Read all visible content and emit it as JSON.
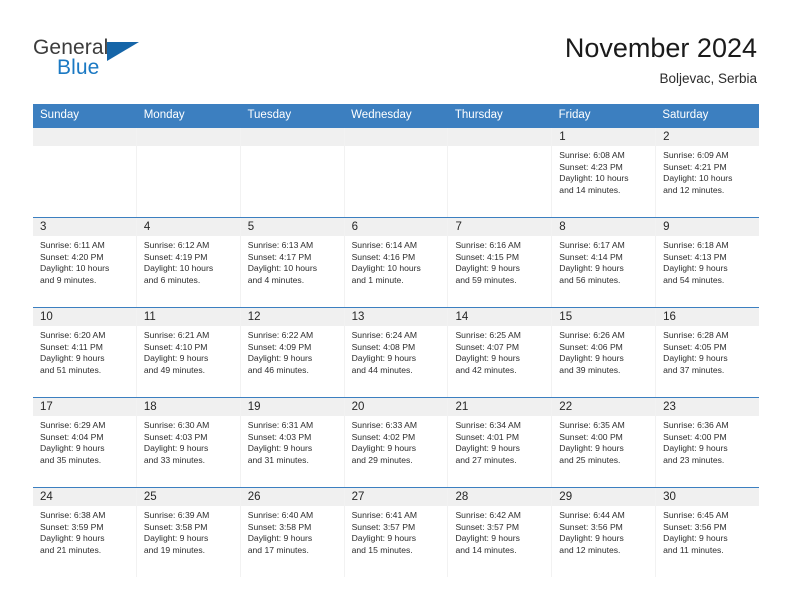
{
  "brand": {
    "name_primary": "General",
    "name_secondary": "Blue",
    "primary_color": "#3c3c3c",
    "secondary_color": "#1b79c3",
    "mark_color": "#1565a8"
  },
  "header": {
    "title": "November 2024",
    "location": "Boljevac, Serbia"
  },
  "calendar": {
    "accent_color": "#3c7fc0",
    "daynum_bg": "#f0f0f0",
    "weekdays": [
      "Sunday",
      "Monday",
      "Tuesday",
      "Wednesday",
      "Thursday",
      "Friday",
      "Saturday"
    ],
    "weeks": [
      [
        {
          "day": "",
          "sunrise": "",
          "sunset": "",
          "daylight_1": "",
          "daylight_2": ""
        },
        {
          "day": "",
          "sunrise": "",
          "sunset": "",
          "daylight_1": "",
          "daylight_2": ""
        },
        {
          "day": "",
          "sunrise": "",
          "sunset": "",
          "daylight_1": "",
          "daylight_2": ""
        },
        {
          "day": "",
          "sunrise": "",
          "sunset": "",
          "daylight_1": "",
          "daylight_2": ""
        },
        {
          "day": "",
          "sunrise": "",
          "sunset": "",
          "daylight_1": "",
          "daylight_2": ""
        },
        {
          "day": "1",
          "sunrise": "Sunrise: 6:08 AM",
          "sunset": "Sunset: 4:23 PM",
          "daylight_1": "Daylight: 10 hours",
          "daylight_2": "and 14 minutes."
        },
        {
          "day": "2",
          "sunrise": "Sunrise: 6:09 AM",
          "sunset": "Sunset: 4:21 PM",
          "daylight_1": "Daylight: 10 hours",
          "daylight_2": "and 12 minutes."
        }
      ],
      [
        {
          "day": "3",
          "sunrise": "Sunrise: 6:11 AM",
          "sunset": "Sunset: 4:20 PM",
          "daylight_1": "Daylight: 10 hours",
          "daylight_2": "and 9 minutes."
        },
        {
          "day": "4",
          "sunrise": "Sunrise: 6:12 AM",
          "sunset": "Sunset: 4:19 PM",
          "daylight_1": "Daylight: 10 hours",
          "daylight_2": "and 6 minutes."
        },
        {
          "day": "5",
          "sunrise": "Sunrise: 6:13 AM",
          "sunset": "Sunset: 4:17 PM",
          "daylight_1": "Daylight: 10 hours",
          "daylight_2": "and 4 minutes."
        },
        {
          "day": "6",
          "sunrise": "Sunrise: 6:14 AM",
          "sunset": "Sunset: 4:16 PM",
          "daylight_1": "Daylight: 10 hours",
          "daylight_2": "and 1 minute."
        },
        {
          "day": "7",
          "sunrise": "Sunrise: 6:16 AM",
          "sunset": "Sunset: 4:15 PM",
          "daylight_1": "Daylight: 9 hours",
          "daylight_2": "and 59 minutes."
        },
        {
          "day": "8",
          "sunrise": "Sunrise: 6:17 AM",
          "sunset": "Sunset: 4:14 PM",
          "daylight_1": "Daylight: 9 hours",
          "daylight_2": "and 56 minutes."
        },
        {
          "day": "9",
          "sunrise": "Sunrise: 6:18 AM",
          "sunset": "Sunset: 4:13 PM",
          "daylight_1": "Daylight: 9 hours",
          "daylight_2": "and 54 minutes."
        }
      ],
      [
        {
          "day": "10",
          "sunrise": "Sunrise: 6:20 AM",
          "sunset": "Sunset: 4:11 PM",
          "daylight_1": "Daylight: 9 hours",
          "daylight_2": "and 51 minutes."
        },
        {
          "day": "11",
          "sunrise": "Sunrise: 6:21 AM",
          "sunset": "Sunset: 4:10 PM",
          "daylight_1": "Daylight: 9 hours",
          "daylight_2": "and 49 minutes."
        },
        {
          "day": "12",
          "sunrise": "Sunrise: 6:22 AM",
          "sunset": "Sunset: 4:09 PM",
          "daylight_1": "Daylight: 9 hours",
          "daylight_2": "and 46 minutes."
        },
        {
          "day": "13",
          "sunrise": "Sunrise: 6:24 AM",
          "sunset": "Sunset: 4:08 PM",
          "daylight_1": "Daylight: 9 hours",
          "daylight_2": "and 44 minutes."
        },
        {
          "day": "14",
          "sunrise": "Sunrise: 6:25 AM",
          "sunset": "Sunset: 4:07 PM",
          "daylight_1": "Daylight: 9 hours",
          "daylight_2": "and 42 minutes."
        },
        {
          "day": "15",
          "sunrise": "Sunrise: 6:26 AM",
          "sunset": "Sunset: 4:06 PM",
          "daylight_1": "Daylight: 9 hours",
          "daylight_2": "and 39 minutes."
        },
        {
          "day": "16",
          "sunrise": "Sunrise: 6:28 AM",
          "sunset": "Sunset: 4:05 PM",
          "daylight_1": "Daylight: 9 hours",
          "daylight_2": "and 37 minutes."
        }
      ],
      [
        {
          "day": "17",
          "sunrise": "Sunrise: 6:29 AM",
          "sunset": "Sunset: 4:04 PM",
          "daylight_1": "Daylight: 9 hours",
          "daylight_2": "and 35 minutes."
        },
        {
          "day": "18",
          "sunrise": "Sunrise: 6:30 AM",
          "sunset": "Sunset: 4:03 PM",
          "daylight_1": "Daylight: 9 hours",
          "daylight_2": "and 33 minutes."
        },
        {
          "day": "19",
          "sunrise": "Sunrise: 6:31 AM",
          "sunset": "Sunset: 4:03 PM",
          "daylight_1": "Daylight: 9 hours",
          "daylight_2": "and 31 minutes."
        },
        {
          "day": "20",
          "sunrise": "Sunrise: 6:33 AM",
          "sunset": "Sunset: 4:02 PM",
          "daylight_1": "Daylight: 9 hours",
          "daylight_2": "and 29 minutes."
        },
        {
          "day": "21",
          "sunrise": "Sunrise: 6:34 AM",
          "sunset": "Sunset: 4:01 PM",
          "daylight_1": "Daylight: 9 hours",
          "daylight_2": "and 27 minutes."
        },
        {
          "day": "22",
          "sunrise": "Sunrise: 6:35 AM",
          "sunset": "Sunset: 4:00 PM",
          "daylight_1": "Daylight: 9 hours",
          "daylight_2": "and 25 minutes."
        },
        {
          "day": "23",
          "sunrise": "Sunrise: 6:36 AM",
          "sunset": "Sunset: 4:00 PM",
          "daylight_1": "Daylight: 9 hours",
          "daylight_2": "and 23 minutes."
        }
      ],
      [
        {
          "day": "24",
          "sunrise": "Sunrise: 6:38 AM",
          "sunset": "Sunset: 3:59 PM",
          "daylight_1": "Daylight: 9 hours",
          "daylight_2": "and 21 minutes."
        },
        {
          "day": "25",
          "sunrise": "Sunrise: 6:39 AM",
          "sunset": "Sunset: 3:58 PM",
          "daylight_1": "Daylight: 9 hours",
          "daylight_2": "and 19 minutes."
        },
        {
          "day": "26",
          "sunrise": "Sunrise: 6:40 AM",
          "sunset": "Sunset: 3:58 PM",
          "daylight_1": "Daylight: 9 hours",
          "daylight_2": "and 17 minutes."
        },
        {
          "day": "27",
          "sunrise": "Sunrise: 6:41 AM",
          "sunset": "Sunset: 3:57 PM",
          "daylight_1": "Daylight: 9 hours",
          "daylight_2": "and 15 minutes."
        },
        {
          "day": "28",
          "sunrise": "Sunrise: 6:42 AM",
          "sunset": "Sunset: 3:57 PM",
          "daylight_1": "Daylight: 9 hours",
          "daylight_2": "and 14 minutes."
        },
        {
          "day": "29",
          "sunrise": "Sunrise: 6:44 AM",
          "sunset": "Sunset: 3:56 PM",
          "daylight_1": "Daylight: 9 hours",
          "daylight_2": "and 12 minutes."
        },
        {
          "day": "30",
          "sunrise": "Sunrise: 6:45 AM",
          "sunset": "Sunset: 3:56 PM",
          "daylight_1": "Daylight: 9 hours",
          "daylight_2": "and 11 minutes."
        }
      ]
    ]
  }
}
